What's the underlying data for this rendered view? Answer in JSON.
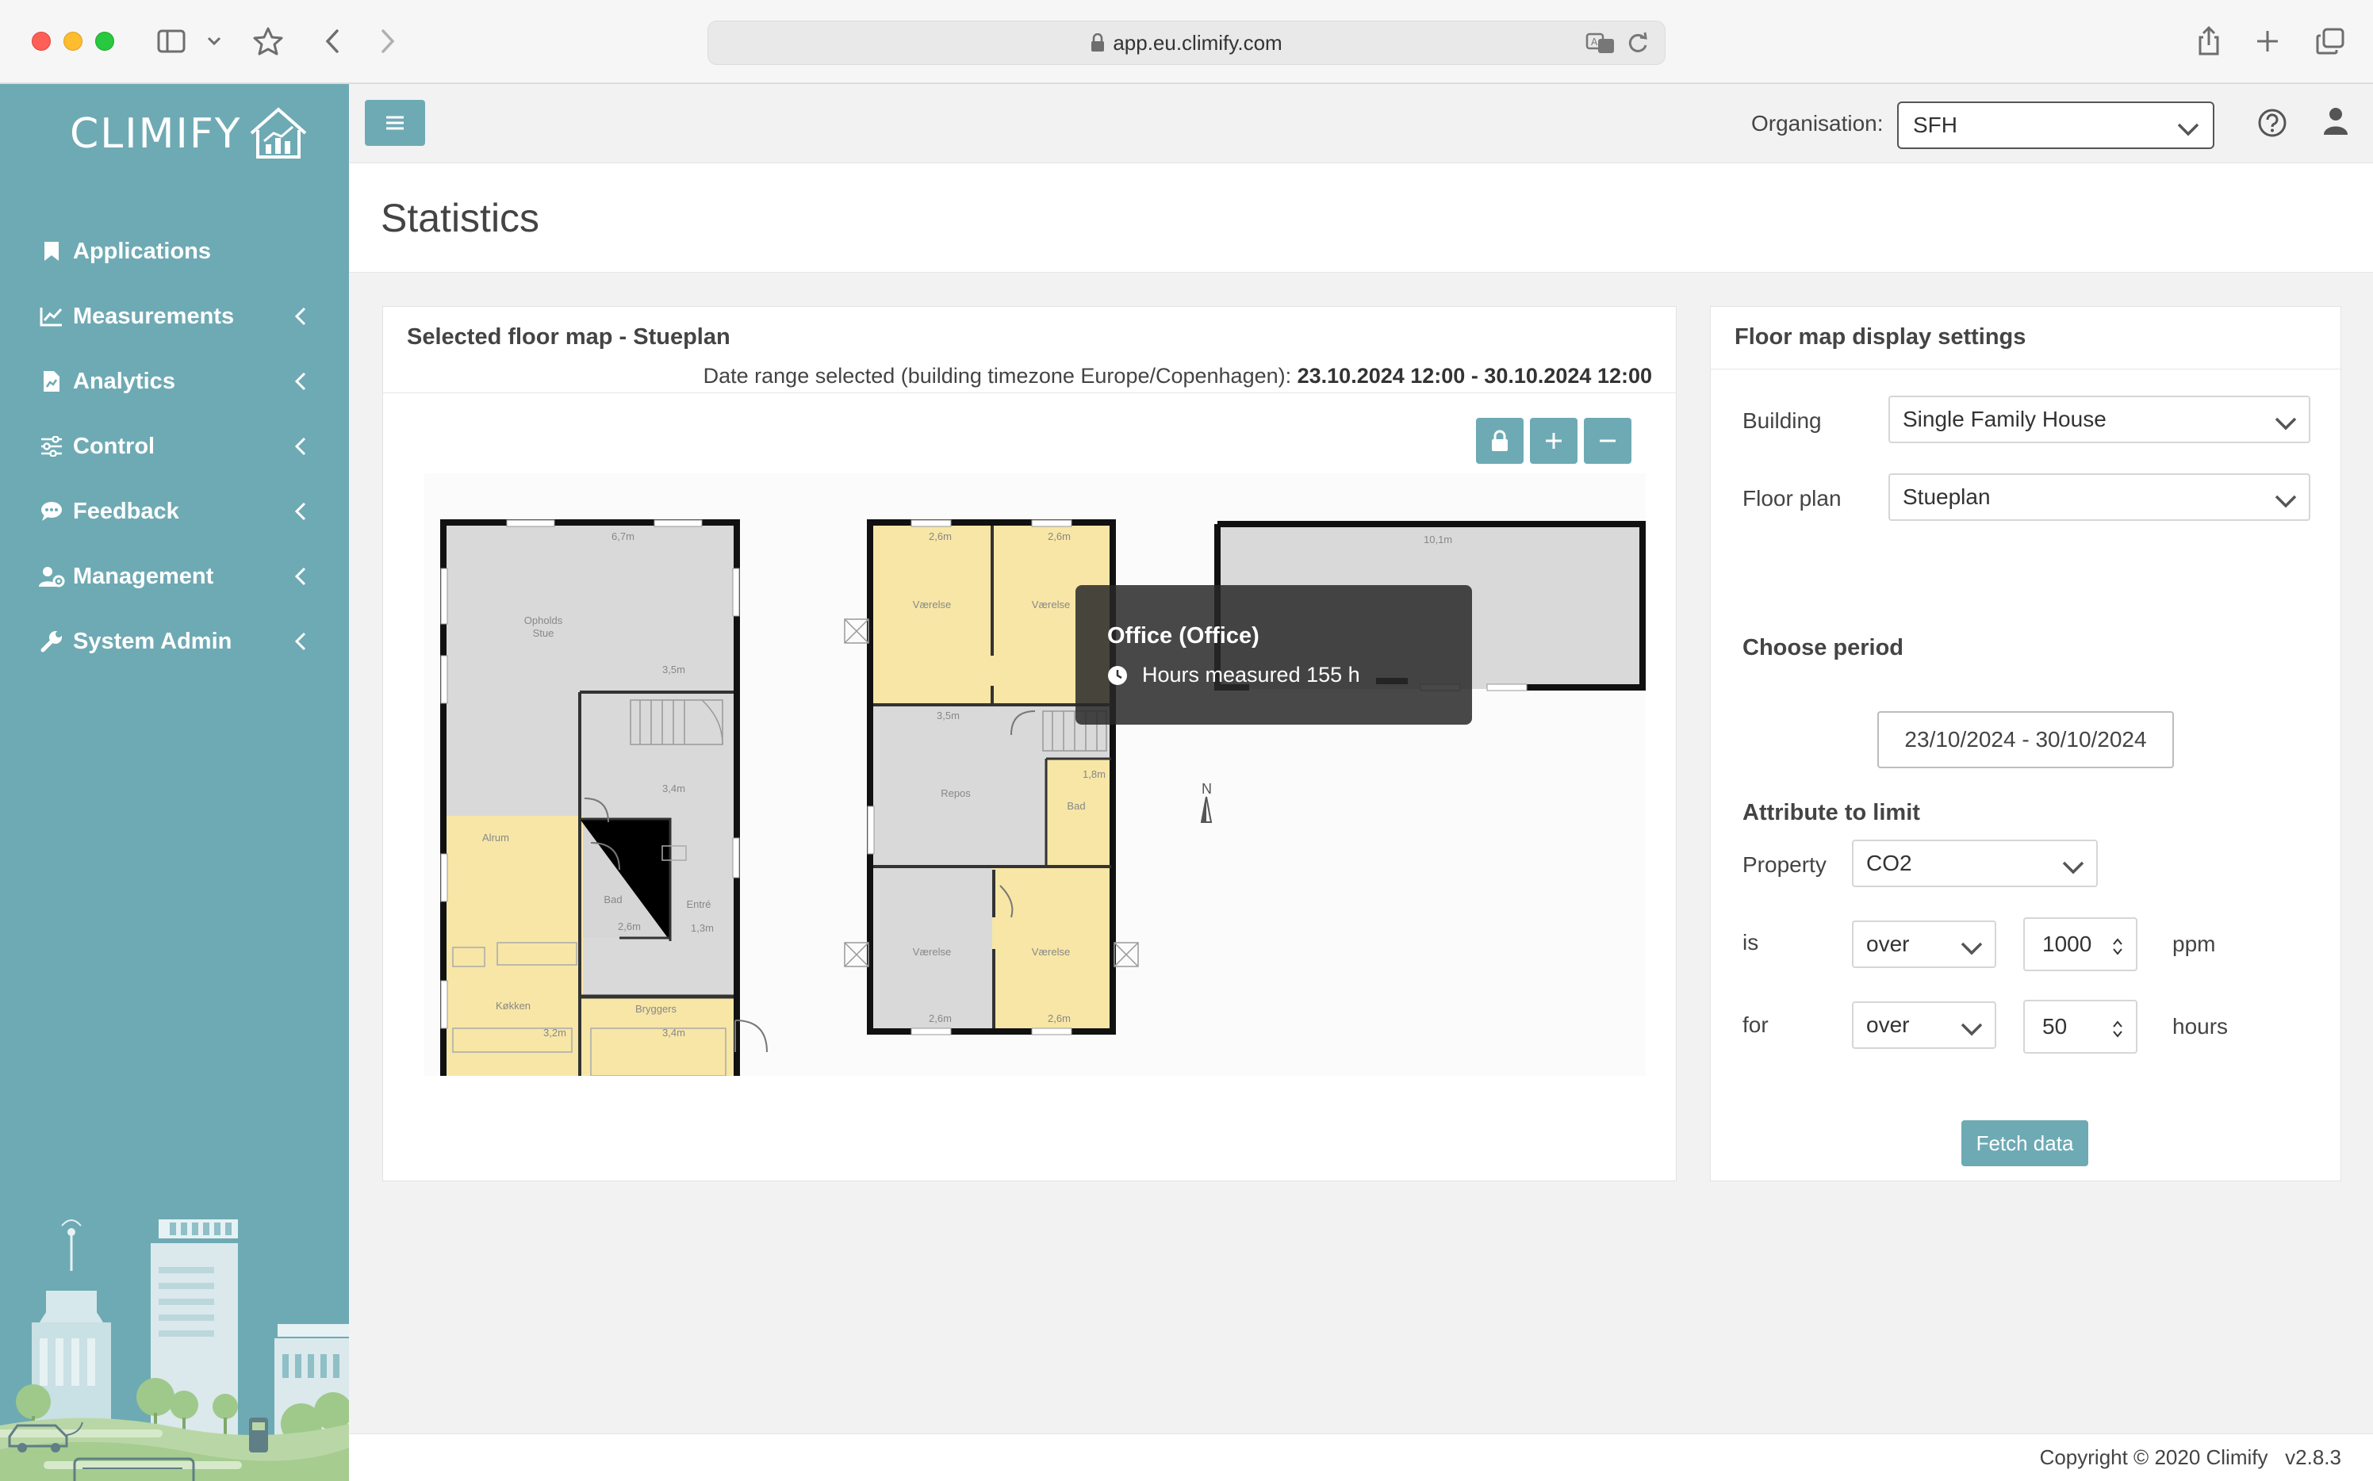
{
  "browser": {
    "url": "app.eu.climify.com"
  },
  "sidebar": {
    "logo_text": "CLIMIFY",
    "items": [
      {
        "label": "Applications",
        "icon": "bookmark-icon",
        "has_submenu": false
      },
      {
        "label": "Measurements",
        "icon": "line-chart-icon",
        "has_submenu": true
      },
      {
        "label": "Analytics",
        "icon": "file-chart-icon",
        "has_submenu": true
      },
      {
        "label": "Control",
        "icon": "sliders-icon",
        "has_submenu": true
      },
      {
        "label": "Feedback",
        "icon": "comment-icon",
        "has_submenu": true
      },
      {
        "label": "Management",
        "icon": "user-gear-icon",
        "has_submenu": true
      },
      {
        "label": "System Admin",
        "icon": "wrench-icon",
        "has_submenu": true
      }
    ]
  },
  "topbar": {
    "organisation_label": "Organisation:",
    "organisation_value": "SFH"
  },
  "page": {
    "title": "Statistics"
  },
  "floor_panel": {
    "title": "Selected floor map - Stueplan",
    "date_range_prefix": "Date range selected (building timezone Europe/Copenhagen): ",
    "date_range_value": "23.10.2024 12:00 - 30.10.2024 12:00",
    "map_labels": {
      "room_stue": "Opholds\nStue",
      "room_alrum": "Alrum",
      "room_kokken": "Køkken",
      "room_bryggers": "Bryggers",
      "room_bad1": "Bad",
      "room_entre": "Entré",
      "room_vaer1": "Værelse",
      "room_vaer2": "Værelse",
      "room_vaer3": "Værelse",
      "room_vaer4": "Værelse",
      "room_repos": "Repos",
      "room_bad2": "Bad",
      "north": "N"
    },
    "tooltip": {
      "title": "Office (Office)",
      "line": "Hours measured 155 h"
    }
  },
  "settings_panel": {
    "title": "Floor map display settings",
    "building_label": "Building",
    "building_value": "Single Family House",
    "floorplan_label": "Floor plan",
    "floorplan_value": "Stueplan",
    "period_title": "Choose period",
    "period_value": "23/10/2024 - 30/10/2024",
    "attribute_title": "Attribute to limit",
    "property_label": "Property",
    "property_value": "CO2",
    "is_label": "is",
    "is_operator": "over",
    "is_value": "1000",
    "is_unit": "ppm",
    "for_label": "for",
    "for_operator": "over",
    "for_value": "50",
    "for_unit": "hours",
    "fetch_label": "Fetch data"
  },
  "footer": {
    "copyright": "Copyright © 2020 Climify   v2.8.3"
  },
  "colors": {
    "accent": "#6eaab4",
    "room_highlight": "#f7e6a6",
    "room_grey": "#d9d9d9"
  }
}
